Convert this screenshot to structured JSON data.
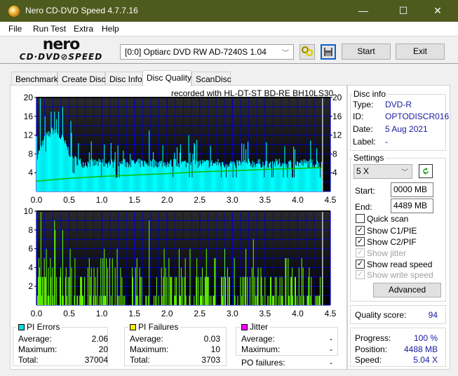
{
  "window": {
    "title": "Nero CD-DVD Speed 4.7.7.16",
    "minimize_glyph": "—",
    "maximize_glyph": "☐",
    "close_glyph": "✕"
  },
  "menu": [
    "File",
    "Run Test",
    "Extra",
    "Help"
  ],
  "toolbar": {
    "logo_top": "nero",
    "logo_bottom": "CD·DVD⊘SPEED",
    "drive": "[0:0]  Optiarc DVD RW AD-7240S 1.04",
    "start_label": "Start",
    "exit_label": "Exit",
    "icons": [
      "drive-settings-icon",
      "save-icon"
    ]
  },
  "tabs": [
    {
      "label": "Benchmark",
      "active": false
    },
    {
      "label": "Create Disc",
      "active": false
    },
    {
      "label": "Disc Info",
      "active": false
    },
    {
      "label": "Disc Quality",
      "active": true
    },
    {
      "label": "ScanDisc",
      "active": false
    }
  ],
  "chart_caption": "recorded with HL-DT-ST BD-RE  BH10LS30",
  "disc_info": {
    "title": "Disc info",
    "type_label": "Type:",
    "type": "DVD-R",
    "id_label": "ID:",
    "id": "OPTODISCR016",
    "date_label": "Date:",
    "date": "5 Aug 2021",
    "label_label": "Label:",
    "label": "-"
  },
  "settings": {
    "title": "Settings",
    "speed": "5 X",
    "start_label": "Start:",
    "start": "0000 MB",
    "end_label": "End:",
    "end": "4489 MB",
    "checkboxes": [
      {
        "label": "Quick scan",
        "checked": false,
        "enabled": true
      },
      {
        "label": "Show C1/PIE",
        "checked": true,
        "enabled": true
      },
      {
        "label": "Show C2/PIF",
        "checked": true,
        "enabled": true
      },
      {
        "label": "Show jitter",
        "checked": true,
        "enabled": false
      },
      {
        "label": "Show read speed",
        "checked": true,
        "enabled": true
      },
      {
        "label": "Show write speed",
        "checked": true,
        "enabled": false
      }
    ],
    "advanced_label": "Advanced"
  },
  "quality": {
    "label": "Quality score:",
    "value": "94"
  },
  "progress": {
    "progress_label": "Progress:",
    "progress": "100 %",
    "position_label": "Position:",
    "position": "4488 MB",
    "speed_label": "Speed:",
    "speed": "5.04 X"
  },
  "stats": {
    "pi_errors": {
      "title": "PI Errors",
      "color": "#00e0e0",
      "avg_label": "Average:",
      "avg": "2.06",
      "max_label": "Maximum:",
      "max": "20",
      "total_label": "Total:",
      "total": "37004"
    },
    "pi_failures": {
      "title": "PI Failures",
      "color": "#f0f000",
      "avg_label": "Average:",
      "avg": "0.03",
      "max_label": "Maximum:",
      "max": "10",
      "total_label": "Total:",
      "total": "3703"
    },
    "jitter": {
      "title": "Jitter",
      "color": "#ff00ff",
      "avg_label": "Average:",
      "avg": "-",
      "max_label": "Maximum:",
      "max": "-"
    },
    "po_failures_label": "PO failures:",
    "po_failures": "-"
  },
  "chart_data": [
    {
      "type": "bar",
      "title": "PI Errors",
      "x_ticks": [
        "0.0",
        "0.5",
        "1.0",
        "1.5",
        "2.0",
        "2.5",
        "3.0",
        "3.5",
        "4.0",
        "4.5"
      ],
      "y_ticks_left": [
        "20",
        "16",
        "12",
        "8",
        "4"
      ],
      "y_ticks_right": [
        "20",
        "16",
        "12",
        "8",
        "4"
      ],
      "xlim": [
        0,
        4.5
      ],
      "ylim": [
        0,
        20
      ],
      "data_end": 4.38,
      "bar_color": "#00ffff",
      "speed_color": "#00c000",
      "speed_line": {
        "x": [
          0,
          0.5,
          1.0,
          1.5,
          2.0,
          2.5,
          3.0,
          3.5,
          4.0,
          4.38
        ],
        "y": [
          2.2,
          2.8,
          3.2,
          3.5,
          3.8,
          4.2,
          4.4,
          4.7,
          4.9,
          5.1
        ]
      },
      "peaks": [
        {
          "x": 0.05,
          "y": 20
        },
        {
          "x": 0.12,
          "y": 16
        },
        {
          "x": 0.22,
          "y": 17
        },
        {
          "x": 0.27,
          "y": 17
        },
        {
          "x": 0.33,
          "y": 17
        },
        {
          "x": 0.4,
          "y": 18
        },
        {
          "x": 0.52,
          "y": 15
        },
        {
          "x": 1.03,
          "y": 10
        },
        {
          "x": 1.72,
          "y": 13
        },
        {
          "x": 2.33,
          "y": 12
        },
        {
          "x": 2.2,
          "y": 10
        },
        {
          "x": 3.2,
          "y": 9
        },
        {
          "x": 3.95,
          "y": 9
        },
        {
          "x": 2.42,
          "y": 10
        }
      ],
      "baseline_profile": {
        "x": [
          0,
          0.1,
          0.25,
          0.4,
          0.55,
          0.7,
          1.0,
          2.0,
          3.0,
          4.38
        ],
        "y": [
          7,
          11,
          13,
          11,
          7,
          6,
          6,
          6,
          6,
          6
        ]
      }
    },
    {
      "type": "bar",
      "title": "PI Failures",
      "x_ticks": [
        "0.0",
        "0.5",
        "1.0",
        "1.5",
        "2.0",
        "2.5",
        "3.0",
        "3.5",
        "4.0",
        "4.5"
      ],
      "y_ticks_left": [
        "10",
        "8",
        "6",
        "4",
        "2"
      ],
      "xlim": [
        0,
        4.5
      ],
      "ylim": [
        0,
        10
      ],
      "data_end": 4.38,
      "bar_color": "#66ff00",
      "peaks": [
        {
          "x": 0.06,
          "y": 10
        },
        {
          "x": 0.27,
          "y": 9
        },
        {
          "x": 0.28,
          "y": 8
        },
        {
          "x": 0.4,
          "y": 8
        },
        {
          "x": 0.51,
          "y": 6
        },
        {
          "x": 0.15,
          "y": 6
        },
        {
          "x": 1.03,
          "y": 6
        },
        {
          "x": 1.23,
          "y": 6
        },
        {
          "x": 1.72,
          "y": 9
        },
        {
          "x": 1.95,
          "y": 6
        },
        {
          "x": 2.18,
          "y": 6
        },
        {
          "x": 2.35,
          "y": 6
        },
        {
          "x": 2.6,
          "y": 6
        },
        {
          "x": 2.88,
          "y": 6
        },
        {
          "x": 3.2,
          "y": 6
        },
        {
          "x": 3.32,
          "y": 7
        },
        {
          "x": 2.02,
          "y": 5
        },
        {
          "x": 2.45,
          "y": 5
        },
        {
          "x": 3.3,
          "y": 4
        },
        {
          "x": 3.82,
          "y": 5
        }
      ]
    }
  ]
}
